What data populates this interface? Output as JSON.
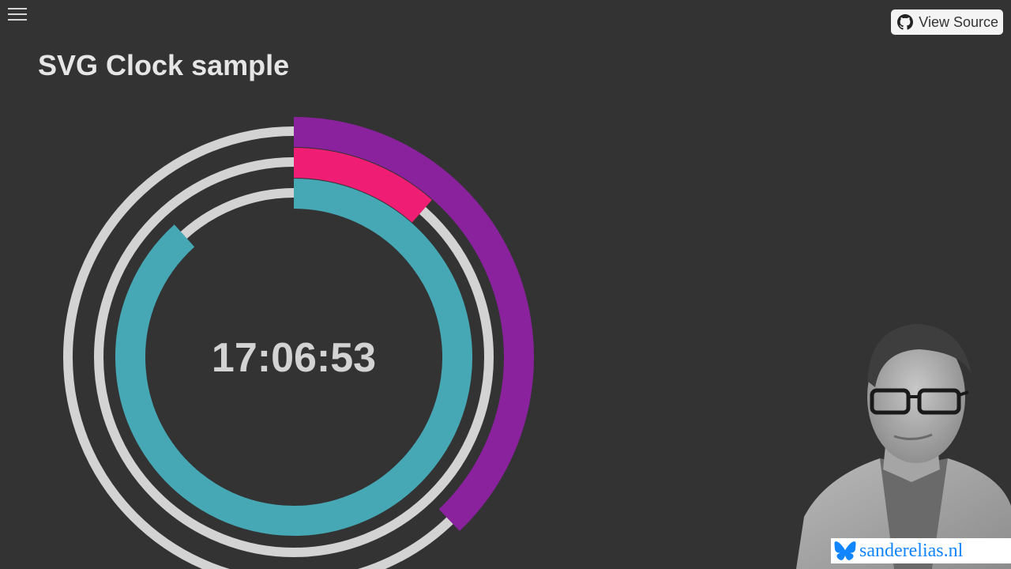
{
  "header": {
    "menu_icon": "hamburger-menu-icon",
    "view_source_label": "View Source",
    "github_icon": "github-icon"
  },
  "main": {
    "title": "SVG Clock sample"
  },
  "clock": {
    "time_text": "17:06:53",
    "hours": 17,
    "minutes": 6,
    "seconds": 53,
    "hours_fraction": 0.3787,
    "minutes_fraction": 0.1147,
    "seconds_fraction": 0.8833,
    "colors": {
      "track": "#d3d3d3",
      "background": "#333333",
      "hours_arc": "#8a229e",
      "minutes_arc": "#ef1d74",
      "seconds_arc": "#46a7b5"
    }
  },
  "badge": {
    "site_name": "sanderelias.nl",
    "icon": "butterfly-icon",
    "color": "#1185fe"
  },
  "portrait": {
    "icon": "portrait-photo"
  }
}
